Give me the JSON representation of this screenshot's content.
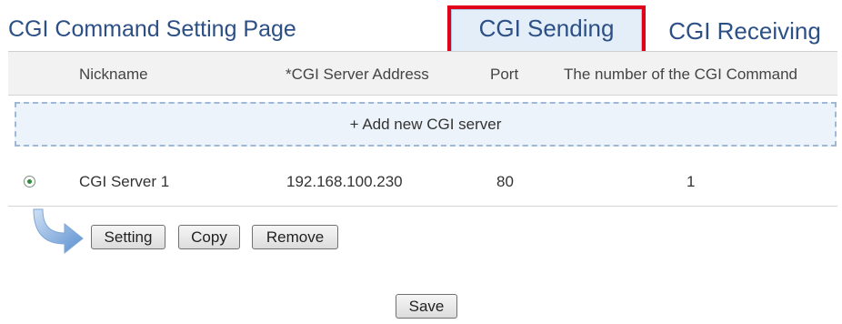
{
  "page": {
    "title": "CGI Command Setting Page"
  },
  "tabs": [
    {
      "label": "CGI Sending",
      "active": true,
      "highlight_color": "#e0001a"
    },
    {
      "label": "CGI Receiving",
      "active": false
    }
  ],
  "table": {
    "headers": {
      "nickname": "Nickname",
      "address": "*CGI Server Address",
      "port": "Port",
      "count": "The number of the CGI Command"
    },
    "add_label": "+ Add new CGI server",
    "rows": [
      {
        "selected": true,
        "nickname": "CGI Server 1",
        "address": "192.168.100.230",
        "port": "80",
        "count": "1"
      }
    ]
  },
  "row_actions": {
    "setting": "Setting",
    "copy": "Copy",
    "remove": "Remove"
  },
  "save_label": "Save",
  "colors": {
    "title": "#2c4f86",
    "active_tab_bg": "#e3eef9",
    "header_bg": "#f2f2f2",
    "add_border": "#9fb8d6"
  }
}
